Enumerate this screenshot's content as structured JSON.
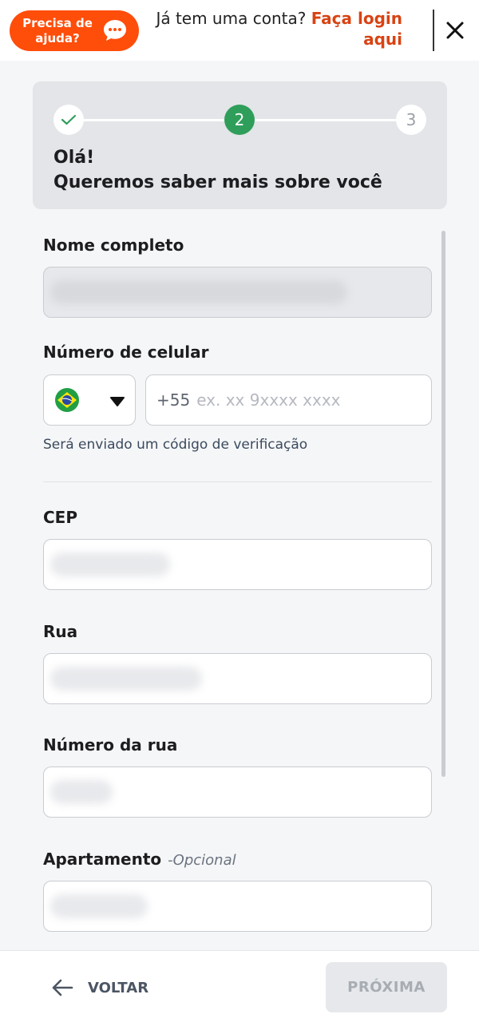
{
  "header": {
    "help_label": "Precisa de ajuda?",
    "login_question": "Já tem uma conta?",
    "login_link": "Faça login aqui",
    "accent_color": "#ff4d0a"
  },
  "stepper": {
    "steps": [
      "",
      "2",
      "3"
    ],
    "current_step": 2,
    "title_line1": "Olá!",
    "title_line2": "Queremos saber mais sobre você",
    "active_color": "#2f9e5b"
  },
  "form": {
    "full_name": {
      "label": "Nome completo",
      "value": ""
    },
    "phone": {
      "label": "Número de celular",
      "country_icon": "brazil-flag-icon",
      "prefix": "+55",
      "placeholder": "ex. xx 9xxxx xxxx",
      "hint": "Será enviado um código de verificação"
    },
    "cep": {
      "label": "CEP",
      "value": ""
    },
    "street": {
      "label": "Rua",
      "value": ""
    },
    "street_number": {
      "label": "Número da rua",
      "value": ""
    },
    "apartment": {
      "label": "Apartamento",
      "optional_tag": "-Opcional",
      "value": ""
    }
  },
  "footer": {
    "back_label": "VOLTAR",
    "next_label": "PRÓXIMA"
  }
}
